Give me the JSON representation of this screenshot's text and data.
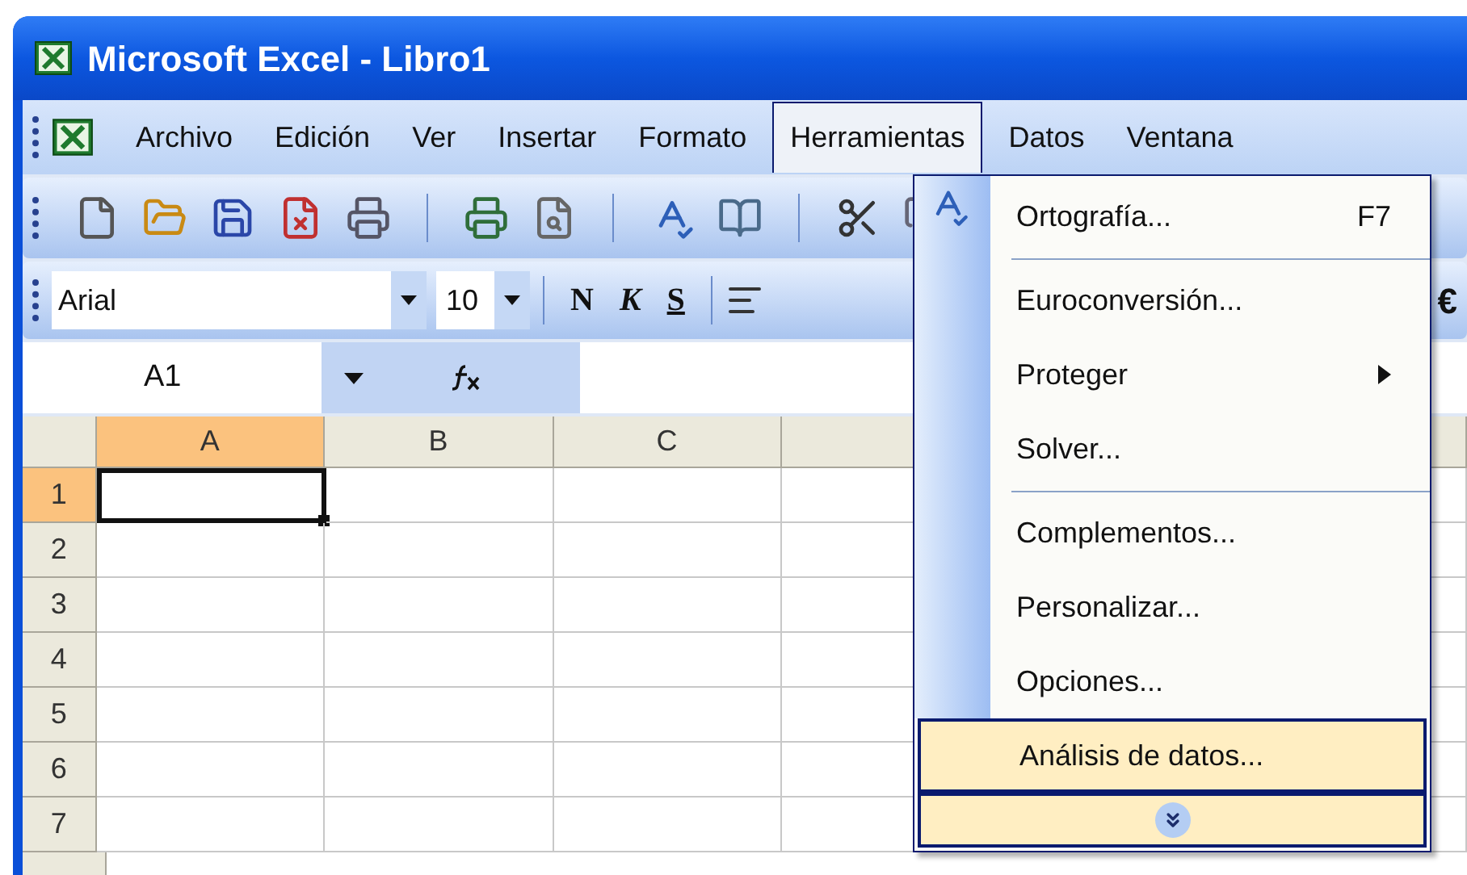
{
  "window": {
    "title": "Microsoft Excel - Libro1"
  },
  "menu_bar": [
    {
      "label": "Archivo",
      "selected": false
    },
    {
      "label": "Edición",
      "selected": false
    },
    {
      "label": "Ver",
      "selected": false
    },
    {
      "label": "Insertar",
      "selected": false
    },
    {
      "label": "Formato",
      "selected": false
    },
    {
      "label": "Herramientas",
      "selected": true
    },
    {
      "label": "Datos",
      "selected": false
    },
    {
      "label": "Ventana",
      "selected": false
    }
  ],
  "format_toolbar": {
    "font": "Arial",
    "size": "10",
    "style_buttons": [
      "N",
      "K",
      "S"
    ],
    "currency": "€"
  },
  "formula_bar": {
    "name_box": "A1"
  },
  "sheet": {
    "columns": [
      {
        "label": "A",
        "selected": true
      },
      {
        "label": "B",
        "selected": false
      },
      {
        "label": "C",
        "selected": false
      }
    ],
    "rows": [
      {
        "label": "1",
        "selected": true
      },
      {
        "label": "2",
        "selected": false
      },
      {
        "label": "3",
        "selected": false
      },
      {
        "label": "4",
        "selected": false
      },
      {
        "label": "5",
        "selected": false
      },
      {
        "label": "6",
        "selected": false
      },
      {
        "label": "7",
        "selected": false
      }
    ]
  },
  "menu": {
    "items": [
      {
        "kind": "item",
        "label": "Ortografía...",
        "shortcut": "F7",
        "submenu": false,
        "selected": false
      },
      {
        "kind": "separator"
      },
      {
        "kind": "item",
        "label": "Euroconversión...",
        "submenu": false,
        "selected": false
      },
      {
        "kind": "item",
        "label": "Proteger",
        "submenu": true,
        "selected": false
      },
      {
        "kind": "item",
        "label": "Solver...",
        "submenu": false,
        "selected": false
      },
      {
        "kind": "separator"
      },
      {
        "kind": "item",
        "label": "Complementos...",
        "submenu": false,
        "selected": false
      },
      {
        "kind": "item",
        "label": "Personalizar...",
        "submenu": false,
        "selected": false
      },
      {
        "kind": "item",
        "label": "Opciones...",
        "submenu": false,
        "selected": false
      },
      {
        "kind": "item",
        "label": "Análisis de datos...",
        "submenu": false,
        "selected": true
      },
      {
        "kind": "expand",
        "selected": true
      }
    ]
  }
}
